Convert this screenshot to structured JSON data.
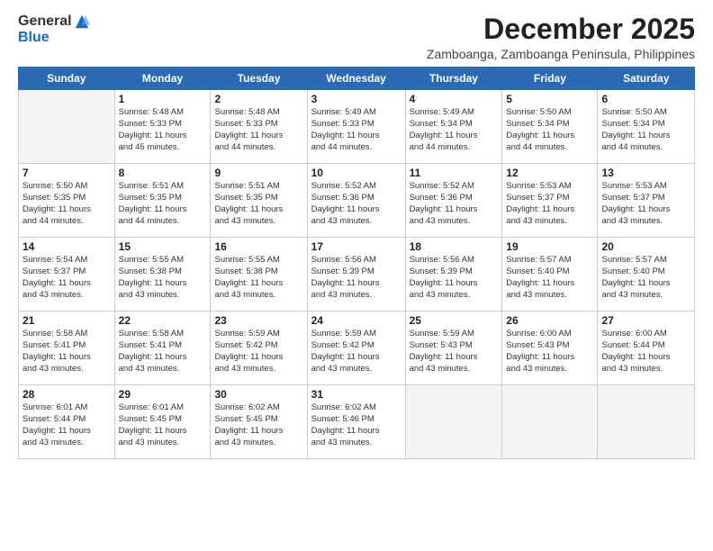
{
  "logo": {
    "general": "General",
    "blue": "Blue"
  },
  "title": "December 2025",
  "subtitle": "Zamboanga, Zamboanga Peninsula, Philippines",
  "days_of_week": [
    "Sunday",
    "Monday",
    "Tuesday",
    "Wednesday",
    "Thursday",
    "Friday",
    "Saturday"
  ],
  "weeks": [
    [
      {
        "day": "",
        "info": ""
      },
      {
        "day": "1",
        "info": "Sunrise: 5:48 AM\nSunset: 5:33 PM\nDaylight: 11 hours\nand 45 minutes."
      },
      {
        "day": "2",
        "info": "Sunrise: 5:48 AM\nSunset: 5:33 PM\nDaylight: 11 hours\nand 44 minutes."
      },
      {
        "day": "3",
        "info": "Sunrise: 5:49 AM\nSunset: 5:33 PM\nDaylight: 11 hours\nand 44 minutes."
      },
      {
        "day": "4",
        "info": "Sunrise: 5:49 AM\nSunset: 5:34 PM\nDaylight: 11 hours\nand 44 minutes."
      },
      {
        "day": "5",
        "info": "Sunrise: 5:50 AM\nSunset: 5:34 PM\nDaylight: 11 hours\nand 44 minutes."
      },
      {
        "day": "6",
        "info": "Sunrise: 5:50 AM\nSunset: 5:34 PM\nDaylight: 11 hours\nand 44 minutes."
      }
    ],
    [
      {
        "day": "7",
        "info": "Sunrise: 5:50 AM\nSunset: 5:35 PM\nDaylight: 11 hours\nand 44 minutes."
      },
      {
        "day": "8",
        "info": "Sunrise: 5:51 AM\nSunset: 5:35 PM\nDaylight: 11 hours\nand 44 minutes."
      },
      {
        "day": "9",
        "info": "Sunrise: 5:51 AM\nSunset: 5:35 PM\nDaylight: 11 hours\nand 43 minutes."
      },
      {
        "day": "10",
        "info": "Sunrise: 5:52 AM\nSunset: 5:36 PM\nDaylight: 11 hours\nand 43 minutes."
      },
      {
        "day": "11",
        "info": "Sunrise: 5:52 AM\nSunset: 5:36 PM\nDaylight: 11 hours\nand 43 minutes."
      },
      {
        "day": "12",
        "info": "Sunrise: 5:53 AM\nSunset: 5:37 PM\nDaylight: 11 hours\nand 43 minutes."
      },
      {
        "day": "13",
        "info": "Sunrise: 5:53 AM\nSunset: 5:37 PM\nDaylight: 11 hours\nand 43 minutes."
      }
    ],
    [
      {
        "day": "14",
        "info": "Sunrise: 5:54 AM\nSunset: 5:37 PM\nDaylight: 11 hours\nand 43 minutes."
      },
      {
        "day": "15",
        "info": "Sunrise: 5:55 AM\nSunset: 5:38 PM\nDaylight: 11 hours\nand 43 minutes."
      },
      {
        "day": "16",
        "info": "Sunrise: 5:55 AM\nSunset: 5:38 PM\nDaylight: 11 hours\nand 43 minutes."
      },
      {
        "day": "17",
        "info": "Sunrise: 5:56 AM\nSunset: 5:39 PM\nDaylight: 11 hours\nand 43 minutes."
      },
      {
        "day": "18",
        "info": "Sunrise: 5:56 AM\nSunset: 5:39 PM\nDaylight: 11 hours\nand 43 minutes."
      },
      {
        "day": "19",
        "info": "Sunrise: 5:57 AM\nSunset: 5:40 PM\nDaylight: 11 hours\nand 43 minutes."
      },
      {
        "day": "20",
        "info": "Sunrise: 5:57 AM\nSunset: 5:40 PM\nDaylight: 11 hours\nand 43 minutes."
      }
    ],
    [
      {
        "day": "21",
        "info": "Sunrise: 5:58 AM\nSunset: 5:41 PM\nDaylight: 11 hours\nand 43 minutes."
      },
      {
        "day": "22",
        "info": "Sunrise: 5:58 AM\nSunset: 5:41 PM\nDaylight: 11 hours\nand 43 minutes."
      },
      {
        "day": "23",
        "info": "Sunrise: 5:59 AM\nSunset: 5:42 PM\nDaylight: 11 hours\nand 43 minutes."
      },
      {
        "day": "24",
        "info": "Sunrise: 5:59 AM\nSunset: 5:42 PM\nDaylight: 11 hours\nand 43 minutes."
      },
      {
        "day": "25",
        "info": "Sunrise: 5:59 AM\nSunset: 5:43 PM\nDaylight: 11 hours\nand 43 minutes."
      },
      {
        "day": "26",
        "info": "Sunrise: 6:00 AM\nSunset: 5:43 PM\nDaylight: 11 hours\nand 43 minutes."
      },
      {
        "day": "27",
        "info": "Sunrise: 6:00 AM\nSunset: 5:44 PM\nDaylight: 11 hours\nand 43 minutes."
      }
    ],
    [
      {
        "day": "28",
        "info": "Sunrise: 6:01 AM\nSunset: 5:44 PM\nDaylight: 11 hours\nand 43 minutes."
      },
      {
        "day": "29",
        "info": "Sunrise: 6:01 AM\nSunset: 5:45 PM\nDaylight: 11 hours\nand 43 minutes."
      },
      {
        "day": "30",
        "info": "Sunrise: 6:02 AM\nSunset: 5:45 PM\nDaylight: 11 hours\nand 43 minutes."
      },
      {
        "day": "31",
        "info": "Sunrise: 6:02 AM\nSunset: 5:46 PM\nDaylight: 11 hours\nand 43 minutes."
      },
      {
        "day": "",
        "info": ""
      },
      {
        "day": "",
        "info": ""
      },
      {
        "day": "",
        "info": ""
      }
    ]
  ]
}
